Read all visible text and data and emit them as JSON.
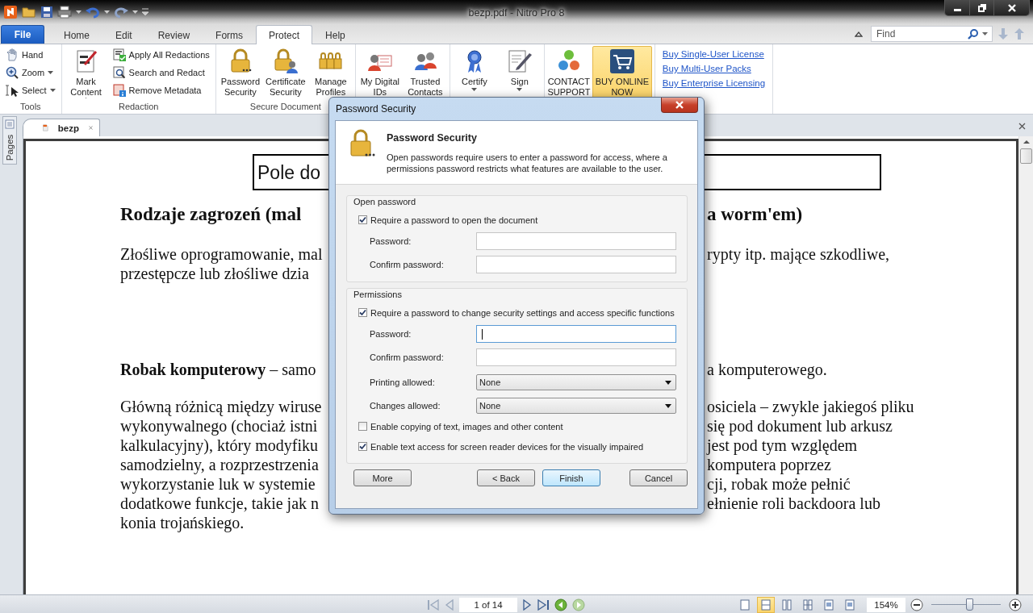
{
  "window": {
    "title": "bezp.pdf - Nitro Pro 8"
  },
  "menu_tabs": [
    {
      "label": "File",
      "kind": "file",
      "selected": false
    },
    {
      "label": "Home",
      "kind": "tab",
      "selected": false
    },
    {
      "label": "Edit",
      "kind": "tab",
      "selected": false
    },
    {
      "label": "Review",
      "kind": "tab",
      "selected": false
    },
    {
      "label": "Forms",
      "kind": "tab",
      "selected": false
    },
    {
      "label": "Protect",
      "kind": "tab",
      "selected": true
    },
    {
      "label": "Help",
      "kind": "tab",
      "selected": false
    }
  ],
  "find": {
    "placeholder": "Find"
  },
  "ribbon": {
    "groups": [
      {
        "label": "Tools",
        "items": [
          {
            "kind": "small",
            "label": "Hand",
            "dropdown": false,
            "highlighted": false
          },
          {
            "kind": "small",
            "label": "Zoom",
            "dropdown": true,
            "highlighted": false
          },
          {
            "kind": "small",
            "label": "Select",
            "dropdown": true,
            "highlighted": false
          }
        ]
      },
      {
        "label": "Redaction",
        "items": [
          {
            "kind": "large",
            "label": "Mark Content",
            "dropdown": true,
            "highlighted": false
          },
          {
            "kind": "small",
            "label": "Apply All Redactions",
            "dropdown": false,
            "highlighted": false
          },
          {
            "kind": "small",
            "label": "Search and Redact",
            "dropdown": false,
            "highlighted": false
          },
          {
            "kind": "small",
            "label": "Remove Metadata",
            "dropdown": false,
            "highlighted": false
          }
        ]
      },
      {
        "label": "Secure Document",
        "items": [
          {
            "kind": "large",
            "label": "Password Security",
            "dropdown": false,
            "highlighted": false
          },
          {
            "kind": "large",
            "label": "Certificate Security",
            "dropdown": false,
            "highlighted": false
          },
          {
            "kind": "large",
            "label": "Manage Profiles",
            "dropdown": false,
            "highlighted": false
          }
        ]
      },
      {
        "items": [
          {
            "kind": "large",
            "label": "My Digital IDs",
            "dropdown": false,
            "highlighted": false
          },
          {
            "kind": "large",
            "label": "Trusted Contacts",
            "dropdown": false,
            "highlighted": false
          }
        ]
      },
      {
        "items": [
          {
            "kind": "large",
            "label": "Certify",
            "dropdown": true,
            "highlighted": false
          },
          {
            "kind": "large",
            "label": "Sign",
            "dropdown": true,
            "highlighted": false
          }
        ]
      },
      {
        "items": [
          {
            "kind": "large",
            "label": "CONTACT SUPPORT",
            "dropdown": false,
            "highlighted": false
          },
          {
            "kind": "large",
            "label": "BUY ONLINE NOW",
            "dropdown": false,
            "highlighted": true
          }
        ]
      },
      {
        "items": [
          {
            "kind": "link",
            "label": "Buy Single-User License"
          },
          {
            "kind": "link",
            "label": "Buy Multi-User Packs"
          },
          {
            "kind": "link",
            "label": "Buy Enterprise Licensing"
          }
        ]
      }
    ]
  },
  "side_panel": {
    "label": "Pages"
  },
  "document_tabs": [
    {
      "label": "bezp",
      "selected": true
    }
  ],
  "document": {
    "blocks": [
      {
        "kind": "field",
        "text": "Pole do"
      },
      {
        "kind": "heading",
        "lines": [
          {
            "left": "Rodzaje zagrozeń (mal",
            "right": "a worm'em)"
          }
        ]
      },
      {
        "kind": "paragraph",
        "lines": [
          {
            "left": "Złośliwe oprogramowanie, mal",
            "right": "rypty itp. mające szkodliwe,"
          },
          {
            "left": "przestępcze lub złośliwe dzia"
          }
        ]
      },
      {
        "kind": "definition",
        "lines": [
          {
            "left": "**Robak komputerowy** – samo",
            "right": "a komputerowego."
          }
        ]
      },
      {
        "kind": "paragraph",
        "lines": [
          {
            "left": "Główną różnicą między wiruse",
            "right": "osiciela – zwykle jakiegoś pliku"
          },
          {
            "left": "wykonywalnego (chociaż istni",
            "right": "się pod dokument lub arkusz"
          },
          {
            "left": "kalkulacyjny), który modyfiku",
            "right": "jest pod tym względem"
          },
          {
            "left": "samodzielny, a rozprzestrzenia",
            "right": "komputera poprzez"
          },
          {
            "left": "wykorzystanie luk w systemie",
            "right": "cji, robak może pełnić"
          },
          {
            "left": "dodatkowe funkcje, takie jak n",
            "right": "ełnienie roli backdoora lub"
          },
          {
            "left": "konia trojańskiego."
          }
        ]
      }
    ]
  },
  "dialog": {
    "title": "Password Security",
    "heading": "Password Security",
    "description": "Open passwords require users to enter a password for access, where a permissions password restricts what features are available to the user.",
    "groups": [
      {
        "legend": "Open password",
        "rows": [
          {
            "kind": "checkbox",
            "label": "Require a password to open the document",
            "checked": true
          },
          {
            "kind": "password",
            "label": "Password:",
            "focused": false
          },
          {
            "kind": "password",
            "label": "Confirm password:",
            "focused": false
          }
        ]
      },
      {
        "legend": "Permissions",
        "rows": [
          {
            "kind": "checkbox",
            "label": "Require a password to change security settings and access specific functions",
            "checked": true
          },
          {
            "kind": "password",
            "label": "Password:",
            "focused": true
          },
          {
            "kind": "password",
            "label": "Confirm password:",
            "focused": false
          },
          {
            "kind": "select",
            "label": "Printing allowed:",
            "value": "None"
          },
          {
            "kind": "select",
            "label": "Changes allowed:",
            "value": "None"
          },
          {
            "kind": "checkbox",
            "label": "Enable copying of text, images and other content",
            "checked": false
          },
          {
            "kind": "checkbox",
            "label": "Enable text access for screen reader devices for the visually impaired",
            "checked": true
          }
        ]
      }
    ],
    "buttons": [
      {
        "label": "More",
        "default": false
      },
      {
        "label": "< Back",
        "default": false
      },
      {
        "label": "Finish",
        "default": true
      },
      {
        "label": "Cancel",
        "default": false
      }
    ]
  },
  "status_bar": {
    "page": "1 of 14",
    "view_modes": [
      {
        "selected": false
      },
      {
        "selected": true
      },
      {
        "selected": false
      },
      {
        "selected": false
      },
      {
        "selected": false
      },
      {
        "selected": false
      }
    ],
    "zoom": "154%",
    "zoom_slider": {
      "level": 0.55
    }
  }
}
